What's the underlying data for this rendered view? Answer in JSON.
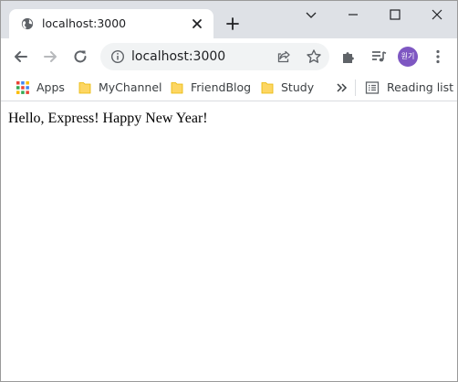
{
  "browser": {
    "tab": {
      "title": "localhost:3000"
    },
    "address_bar": {
      "url": "localhost:3000"
    },
    "profile": {
      "initials": "원기",
      "color": "#7e57c2"
    },
    "bookmarks": [
      {
        "label": "Apps",
        "icon": "apps-grid-icon"
      },
      {
        "label": "MyChannel",
        "icon": "folder-icon"
      },
      {
        "label": "FriendBlog",
        "icon": "folder-icon"
      },
      {
        "label": "Study",
        "icon": "folder-icon"
      }
    ],
    "overflow_label": "»",
    "reading_list": {
      "label": "Reading list",
      "icon": "reading-list-icon"
    }
  },
  "page": {
    "body_text": "Hello, Express! Happy New Year!"
  },
  "colors": {
    "tabstrip": "#dee1e6",
    "omnibox": "#f1f3f4",
    "folder": "#fdd663",
    "folder_edge": "#e8b600",
    "icon": "#5f6368"
  }
}
